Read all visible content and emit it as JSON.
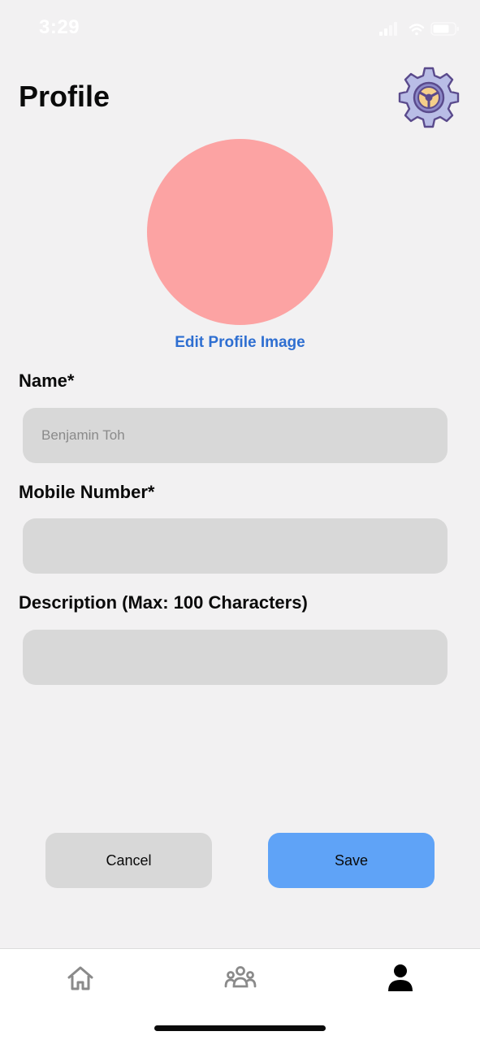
{
  "status_bar": {
    "time": "3:29"
  },
  "header": {
    "title": "Profile",
    "settings_icon": "gear-steering-wheel-icon"
  },
  "avatar": {
    "color": "#fca3a3",
    "edit_label": "Edit Profile Image"
  },
  "form": {
    "name": {
      "label": "Name*",
      "value": "",
      "placeholder": "Benjamin Toh"
    },
    "mobile": {
      "label": "Mobile Number*",
      "value": "",
      "placeholder": ""
    },
    "description": {
      "label": "Description (Max: 100 Characters)",
      "value": "",
      "placeholder": ""
    }
  },
  "actions": {
    "cancel_label": "Cancel",
    "save_label": "Save"
  },
  "tab_bar": {
    "items": [
      {
        "icon": "home-icon",
        "active": false
      },
      {
        "icon": "groups-icon",
        "active": false
      },
      {
        "icon": "person-icon",
        "active": true
      }
    ]
  },
  "colors": {
    "background": "#f2f1f2",
    "input_fill": "#d8d8d8",
    "link": "#2f6fd1",
    "save_button": "#5fa3f7",
    "cancel_button": "#d8d8d8",
    "avatar": "#fca3a3",
    "tab_active": "#000000",
    "tab_inactive": "#8a8a8a"
  }
}
